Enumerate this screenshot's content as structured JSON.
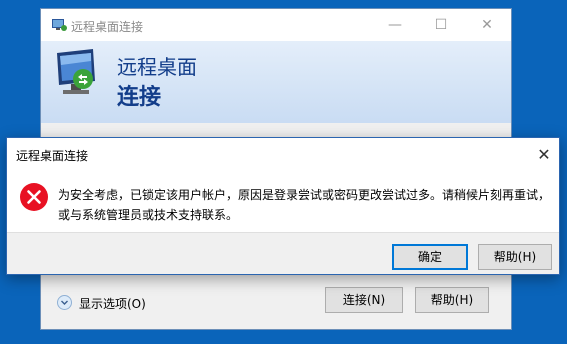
{
  "background_window": {
    "title": "远程桌面连接",
    "header_line1": "远程桌面",
    "header_line2": "连接",
    "titlebar_buttons": {
      "minimize": "—",
      "maximize": "☐",
      "close": "✕"
    },
    "show_options": "显示选项(O)",
    "connect_button": "连接(N)",
    "help_button": "帮助(H)"
  },
  "dialog": {
    "title": "远程桌面连接",
    "close_glyph": "✕",
    "message_line1": "为安全考虑，已锁定该用户帐户，原因是登录尝试或密码更改尝试过多。请稍候片刻再重试，",
    "message_line2": "或与系统管理员或技术支持联系。",
    "ok_button": "确定",
    "help_button": "帮助(H)",
    "icon": "error-icon"
  },
  "colors": {
    "desktop": "#0a64ba",
    "header_text": "#123d8a",
    "error_red": "#e81123",
    "focus_blue": "#0078d7"
  }
}
